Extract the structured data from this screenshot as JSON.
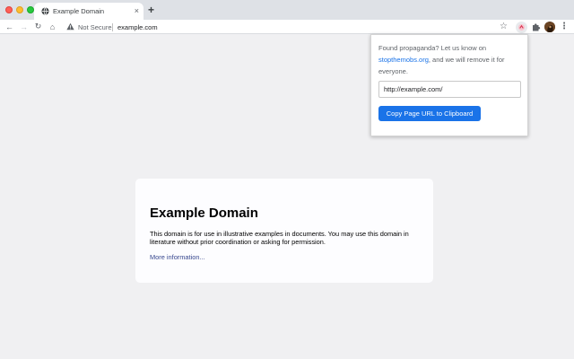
{
  "browser": {
    "tab": {
      "title": "Example Domain",
      "close_glyph": "×",
      "favicon": "globe-icon"
    },
    "new_tab_glyph": "+",
    "toolbar": {
      "back_glyph": "←",
      "forward_glyph": "→",
      "reload_glyph": "↻",
      "home_glyph": "⌂",
      "security_label": "Not Secure",
      "url": "example.com",
      "bookmark_glyph": "☆",
      "menu_glyph": "⋮"
    },
    "icons": {
      "warning": "warning-triangle-icon",
      "extension": "stopthemobs-extension-icon",
      "extensions": "puzzle-icon",
      "profile": "profile-avatar"
    }
  },
  "popup": {
    "message_before": "Found propaganda? Let us know on ",
    "link_text": "stopthemobs.org",
    "message_after": ", and we will remove it for everyone.",
    "input_value": "http://example.com/",
    "button_label": "Copy Page URL to Clipboard"
  },
  "page": {
    "heading": "Example Domain",
    "description": "This domain is for use in illustrative examples in documents. You may use this domain in literature without prior coordination or asking for permission.",
    "more_link": "More information..."
  },
  "colors": {
    "accent": "#1a73e8",
    "page_background": "#f0f0f2",
    "link": "#38488f"
  }
}
